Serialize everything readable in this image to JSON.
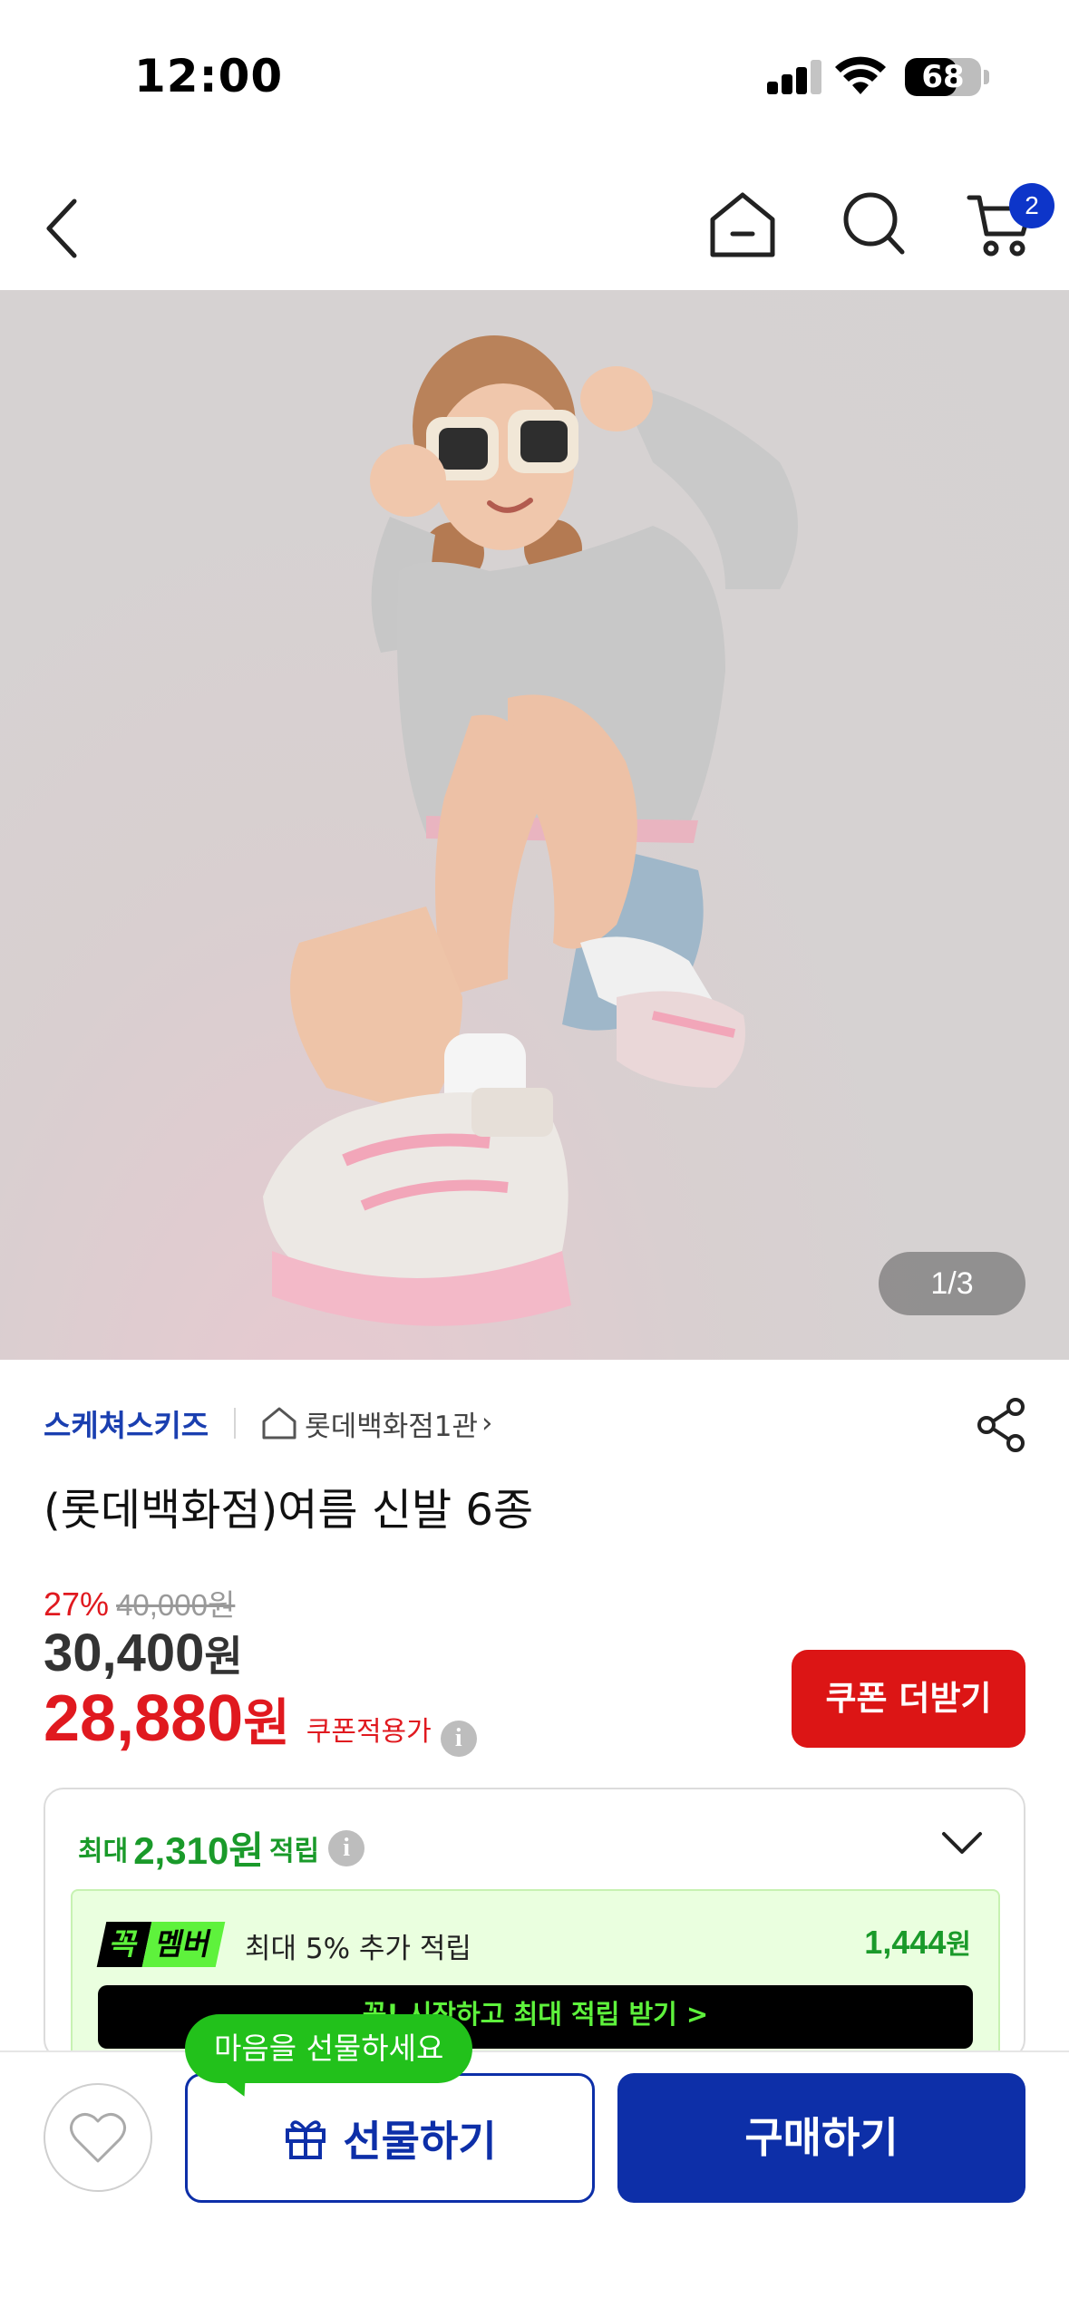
{
  "status_bar": {
    "time": "12:00",
    "battery": "68",
    "battery_level": 0.68,
    "signal_bars": 3
  },
  "nav": {
    "back_icon": "chevron-left-icon",
    "home_icon": "home-icon",
    "search_icon": "search-icon",
    "cart_icon": "cart-icon",
    "cart_count": "2"
  },
  "hero": {
    "image_counter": "1/3"
  },
  "product": {
    "brand": "스케쳐스키즈",
    "store": "롯데백화점1관",
    "store_chevron": "›",
    "title": "(롯데백화점)여름 신발 6종",
    "discount_rate": "27%",
    "original_price": "40,000원",
    "price": "30,400",
    "price_unit": "원",
    "coupon_price": "28,880",
    "coupon_price_unit": "원",
    "coupon_price_label": "쿠폰적용가",
    "coupon_button": "쿠폰 더받기"
  },
  "points": {
    "prefix": "최대",
    "amount": "2,310원",
    "suffix": "적립",
    "member_badge_k": "꼭",
    "member_badge_m": "멤버",
    "member_text": "최대 5% 추가 적립",
    "member_amount": "1,444",
    "member_amount_unit": "원",
    "member_cta": "꼭! 시작하고 최대 적립 받기 >"
  },
  "bottom": {
    "gift_tooltip": "마음을 선물하세요",
    "gift_button": "선물하기",
    "buy_button": "구매하기"
  },
  "colors": {
    "accent_blue": "#0d2fa8",
    "sale_red": "#e0191f",
    "point_green": "#1a9a2a",
    "member_green": "#5ef23c"
  }
}
